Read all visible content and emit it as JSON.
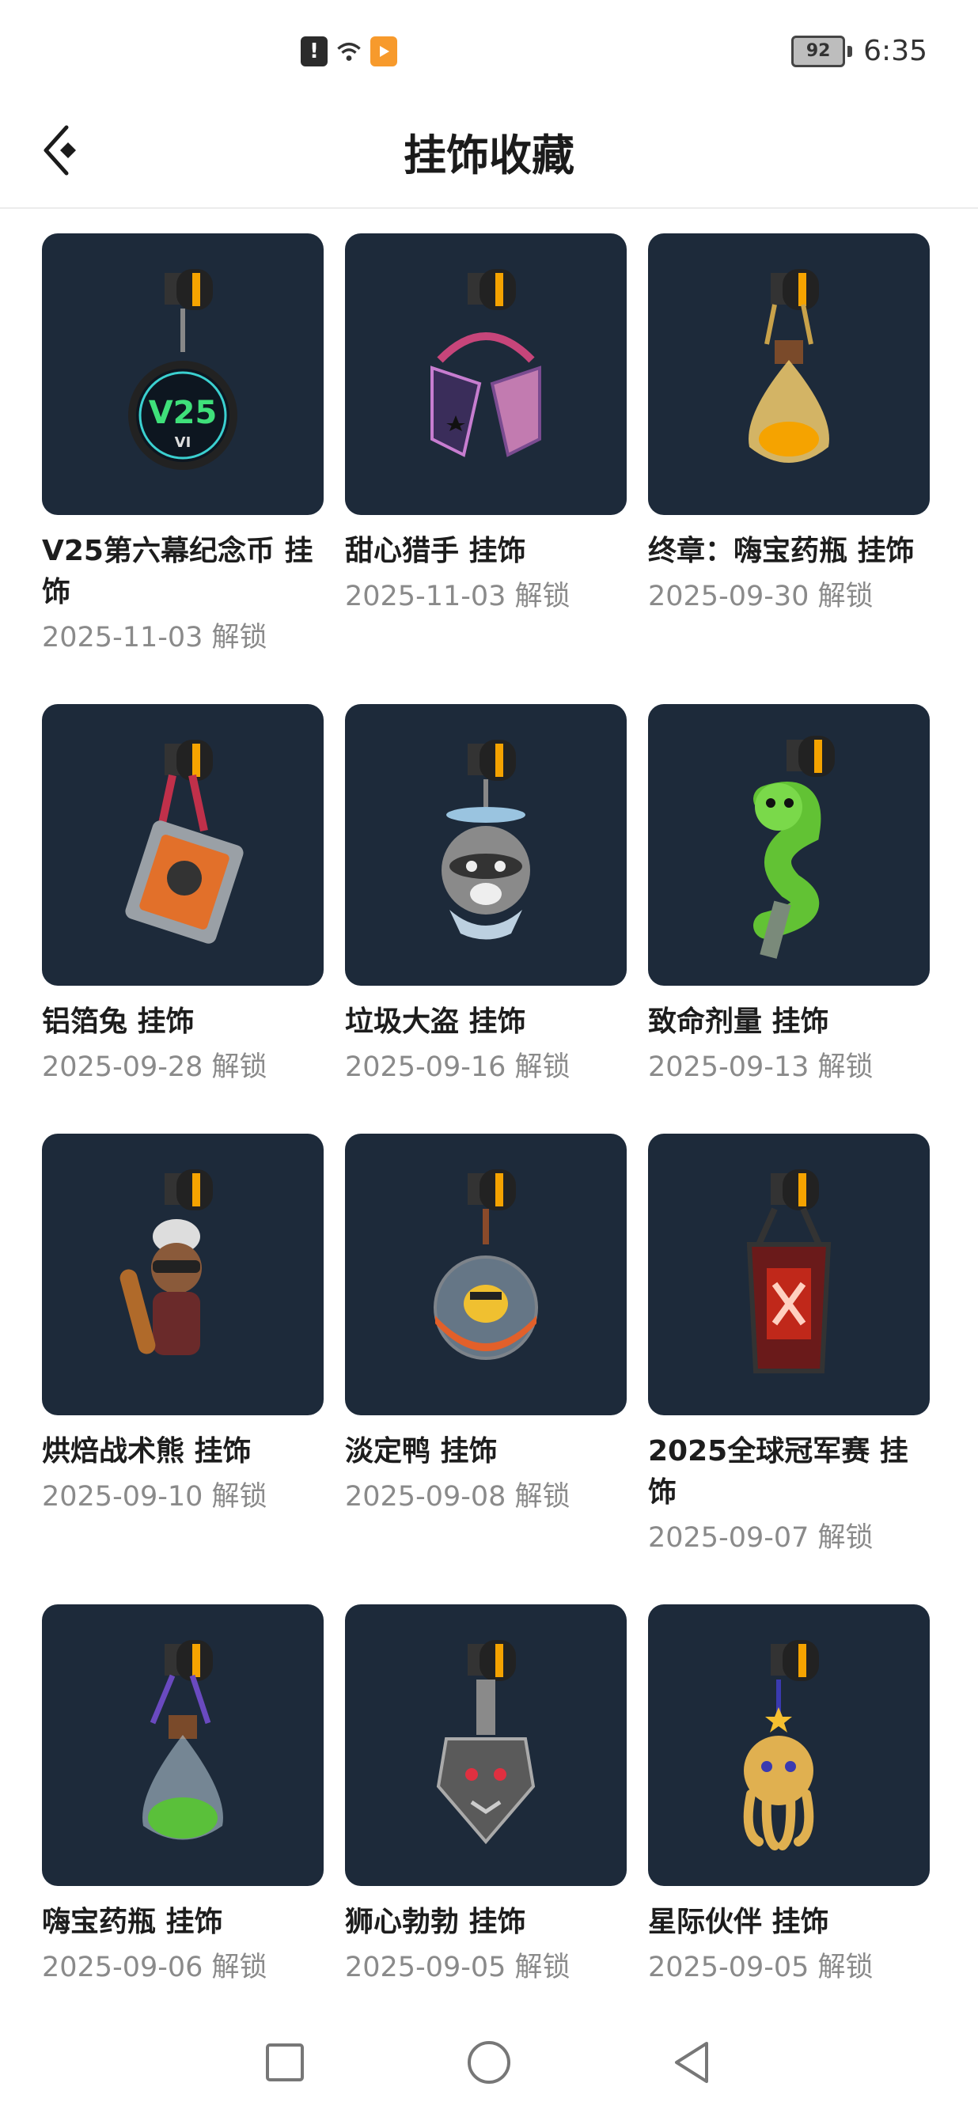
{
  "status_bar": {
    "time": "6:35",
    "battery": "92",
    "icons": [
      "alert-icon",
      "wifi-icon",
      "video-app-icon"
    ]
  },
  "header": {
    "title": "挂饰收藏",
    "back_icon": "back-arrow-icon"
  },
  "items": [
    {
      "name": "V25第六幕纪念币 挂饰",
      "date": "2025-11-03 解锁",
      "art": "coin"
    },
    {
      "name": "甜心猎手 挂饰",
      "date": "2025-11-03 解锁",
      "art": "heart-mask"
    },
    {
      "name": "终章：嗨宝药瓶 挂饰",
      "date": "2025-09-30 解锁",
      "art": "bottle-gold"
    },
    {
      "name": "铝箔兔 挂饰",
      "date": "2025-09-28 解锁",
      "art": "card"
    },
    {
      "name": "垃圾大盗 挂饰",
      "date": "2025-09-16 解锁",
      "art": "raccoon"
    },
    {
      "name": "致命剂量 挂饰",
      "date": "2025-09-13 解锁",
      "art": "snake"
    },
    {
      "name": "烘焙战术熊 挂饰",
      "date": "2025-09-10 解锁",
      "art": "bear"
    },
    {
      "name": "淡定鸭 挂饰",
      "date": "2025-09-08 解锁",
      "art": "duck-ball"
    },
    {
      "name": "2025全球冠军赛 挂饰",
      "date": "2025-09-07 解锁",
      "art": "champions-tag"
    },
    {
      "name": "嗨宝药瓶 挂饰",
      "date": "2025-09-06 解锁",
      "art": "bottle-green"
    },
    {
      "name": "狮心勃勃 挂饰",
      "date": "2025-09-05 解锁",
      "art": "lion-mask"
    },
    {
      "name": "星际伙伴 挂饰",
      "date": "2025-09-05 解锁",
      "art": "octopus"
    }
  ],
  "nav": [
    "recents-square-icon",
    "home-circle-icon",
    "back-triangle-icon"
  ],
  "colors": {
    "card_bg": "#1d2a3a",
    "accent_orange": "#f79a2c",
    "date_gray": "#8a8a8a"
  }
}
